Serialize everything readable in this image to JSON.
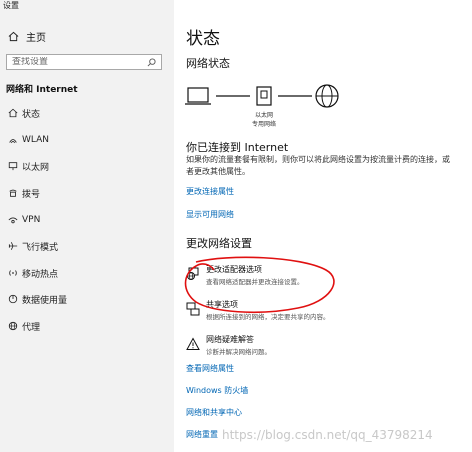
{
  "window_title": "设置",
  "sidebar": {
    "home_label": "主页",
    "search_placeholder": "查找设置",
    "section_title": "网络和 Internet",
    "items": [
      {
        "label": "状态",
        "icon": "home-icon"
      },
      {
        "label": "WLAN",
        "icon": "wifi-icon"
      },
      {
        "label": "以太网",
        "icon": "ethernet-icon"
      },
      {
        "label": "拨号",
        "icon": "dialup-icon"
      },
      {
        "label": "VPN",
        "icon": "vpn-icon"
      },
      {
        "label": "飞行模式",
        "icon": "airplane-icon"
      },
      {
        "label": "移动热点",
        "icon": "hotspot-icon"
      },
      {
        "label": "数据使用量",
        "icon": "data-usage-icon"
      },
      {
        "label": "代理",
        "icon": "globe-icon"
      }
    ]
  },
  "main": {
    "title": "状态",
    "network_status_heading": "网络状态",
    "diagram_label_line1": "以太网",
    "diagram_label_line2": "专用网络",
    "connected_title": "你已连接到 Internet",
    "connected_desc": "如果你的流量套餐有限制，则你可以将此网络设置为按流量计费的连接，或者更改其他属性。",
    "link_change_props": "更改连接属性",
    "link_show_networks": "显示可用网络",
    "change_settings_heading": "更改网络设置",
    "options": [
      {
        "title": "更改适配器选项",
        "desc": "查看网络适配器并更改连接设置。",
        "icon": "adapter-icon"
      },
      {
        "title": "共享选项",
        "desc": "根据所连接到的网络，决定要共享的内容。",
        "icon": "sharing-icon"
      },
      {
        "title": "网络疑难解答",
        "desc": "诊断并解决网络问题。",
        "icon": "warning-icon"
      }
    ],
    "links": [
      "查看网络属性",
      "Windows 防火墙",
      "网络和共享中心",
      "网络重置"
    ]
  },
  "watermark": "https://blog.csdn.net/qq_43798214",
  "colors": {
    "sidebar_bg": "#f2f2f2",
    "link": "#0066b4",
    "annotation": "#e01010"
  }
}
